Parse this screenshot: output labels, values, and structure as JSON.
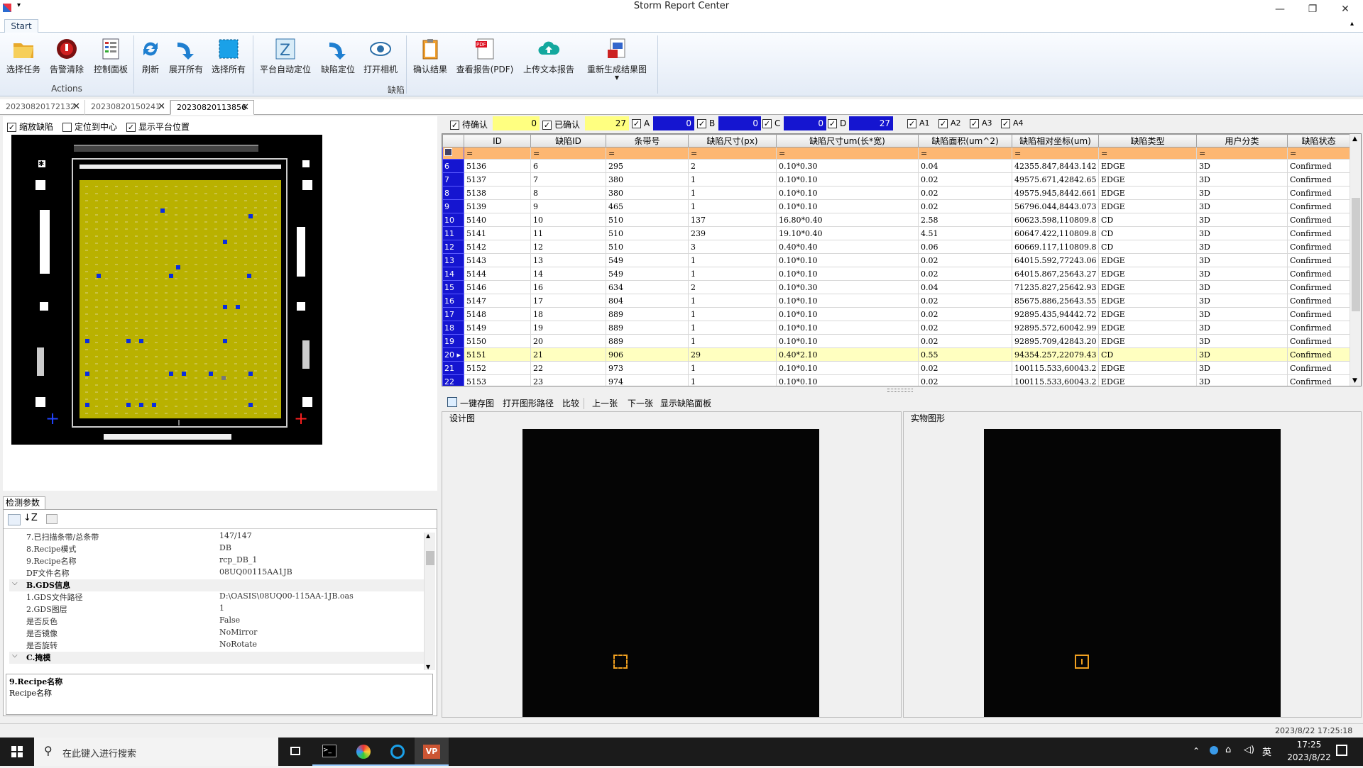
{
  "window": {
    "title": "Storm Report Center"
  },
  "ribbon": {
    "tab": "Start",
    "buttons": [
      {
        "label": "选择任务"
      },
      {
        "label": "告警清除"
      },
      {
        "label": "控制面板"
      },
      {
        "label": "刷新"
      },
      {
        "label": "展开所有"
      },
      {
        "label": "选择所有"
      },
      {
        "label": "平台自动定位"
      },
      {
        "label": "缺陷定位"
      },
      {
        "label": "打开相机"
      },
      {
        "label": "确认结果"
      },
      {
        "label": "查看报告(PDF)"
      },
      {
        "label": "上传文本报告"
      },
      {
        "label": "重新生成结果图"
      }
    ],
    "groups": {
      "actions": "Actions",
      "defects": "缺陷"
    }
  },
  "doc_tabs": [
    {
      "label": "20230820172132"
    },
    {
      "label": "20230820150241"
    },
    {
      "label": "20230820113856"
    }
  ],
  "left": {
    "options": [
      {
        "label": "缩放缺陷",
        "checked": true
      },
      {
        "label": "定位到中心",
        "checked": false
      },
      {
        "label": "显示平台位置",
        "checked": true
      }
    ]
  },
  "params": {
    "tab": "检测参数",
    "rows": [
      {
        "k": "7.已扫描条带/总条带",
        "v": "147/147"
      },
      {
        "k": "8.Recipe模式",
        "v": "DB"
      },
      {
        "k": "9.Recipe名称",
        "v": "rcp_DB_1"
      },
      {
        "k": "DF文件名称",
        "v": "08UQ00115AA1JB"
      },
      {
        "k": "B.GDS信息",
        "v": "",
        "section": true
      },
      {
        "k": "1.GDS文件路径",
        "v": "D:\\OASIS\\08UQ00-115AA-1JB.oas"
      },
      {
        "k": "2.GDS图层",
        "v": "1"
      },
      {
        "k": "是否反色",
        "v": "False"
      },
      {
        "k": "是否镜像",
        "v": "NoMirror"
      },
      {
        "k": "是否旋转",
        "v": "NoRotate"
      },
      {
        "k": "C.掩模",
        "v": "",
        "section": true
      }
    ],
    "desc_title": "9.Recipe名称",
    "desc_text": "Recipe名称"
  },
  "filters": {
    "pending": {
      "label": "待确认",
      "value": "0"
    },
    "confirmed": {
      "label": "已确认",
      "value": "27"
    },
    "a": {
      "label": "A",
      "value": "0"
    },
    "b": {
      "label": "B",
      "value": "0"
    },
    "c": {
      "label": "C",
      "value": "0"
    },
    "d": {
      "label": "D",
      "value": "27"
    },
    "levels": [
      "A1",
      "A2",
      "A3",
      "A4"
    ]
  },
  "grid": {
    "columns": [
      "ID",
      "缺陷ID",
      "条带号",
      "缺陷尺寸(px)",
      "缺陷尺寸um(长*宽)",
      "缺陷面积(um^2)",
      "缺陷相对坐标(um)",
      "缺陷类型",
      "用户分类",
      "缺陷状态"
    ],
    "filter_symbol": "=",
    "rows": [
      {
        "n": "6",
        "id": "5136",
        "did": "6",
        "strip": "295",
        "px": "2",
        "um": "0.10*0.30",
        "area": "0.04",
        "coord": "42355.847,8443.142",
        "type": "EDGE",
        "cls": "3D",
        "st": "Confirmed"
      },
      {
        "n": "7",
        "id": "5137",
        "did": "7",
        "strip": "380",
        "px": "1",
        "um": "0.10*0.10",
        "area": "0.02",
        "coord": "49575.671,42842.65",
        "type": "EDGE",
        "cls": "3D",
        "st": "Confirmed"
      },
      {
        "n": "8",
        "id": "5138",
        "did": "8",
        "strip": "380",
        "px": "1",
        "um": "0.10*0.10",
        "area": "0.02",
        "coord": "49575.945,8442.661",
        "type": "EDGE",
        "cls": "3D",
        "st": "Confirmed"
      },
      {
        "n": "9",
        "id": "5139",
        "did": "9",
        "strip": "465",
        "px": "1",
        "um": "0.10*0.10",
        "area": "0.02",
        "coord": "56796.044,8443.073",
        "type": "EDGE",
        "cls": "3D",
        "st": "Confirmed"
      },
      {
        "n": "10",
        "id": "5140",
        "did": "10",
        "strip": "510",
        "px": "137",
        "um": "16.80*0.40",
        "area": "2.58",
        "coord": "60623.598,110809.8",
        "type": "CD",
        "cls": "3D",
        "st": "Confirmed"
      },
      {
        "n": "11",
        "id": "5141",
        "did": "11",
        "strip": "510",
        "px": "239",
        "um": "19.10*0.40",
        "area": "4.51",
        "coord": "60647.422,110809.8",
        "type": "CD",
        "cls": "3D",
        "st": "Confirmed"
      },
      {
        "n": "12",
        "id": "5142",
        "did": "12",
        "strip": "510",
        "px": "3",
        "um": "0.40*0.40",
        "area": "0.06",
        "coord": "60669.117,110809.8",
        "type": "CD",
        "cls": "3D",
        "st": "Confirmed"
      },
      {
        "n": "13",
        "id": "5143",
        "did": "13",
        "strip": "549",
        "px": "1",
        "um": "0.10*0.10",
        "area": "0.02",
        "coord": "64015.592,77243.06",
        "type": "EDGE",
        "cls": "3D",
        "st": "Confirmed"
      },
      {
        "n": "14",
        "id": "5144",
        "did": "14",
        "strip": "549",
        "px": "1",
        "um": "0.10*0.10",
        "area": "0.02",
        "coord": "64015.867,25643.27",
        "type": "EDGE",
        "cls": "3D",
        "st": "Confirmed"
      },
      {
        "n": "15",
        "id": "5146",
        "did": "16",
        "strip": "634",
        "px": "2",
        "um": "0.10*0.30",
        "area": "0.04",
        "coord": "71235.827,25642.93",
        "type": "EDGE",
        "cls": "3D",
        "st": "Confirmed"
      },
      {
        "n": "16",
        "id": "5147",
        "did": "17",
        "strip": "804",
        "px": "1",
        "um": "0.10*0.10",
        "area": "0.02",
        "coord": "85675.886,25643.55",
        "type": "EDGE",
        "cls": "3D",
        "st": "Confirmed"
      },
      {
        "n": "17",
        "id": "5148",
        "did": "18",
        "strip": "889",
        "px": "1",
        "um": "0.10*0.10",
        "area": "0.02",
        "coord": "92895.435,94442.72",
        "type": "EDGE",
        "cls": "3D",
        "st": "Confirmed"
      },
      {
        "n": "18",
        "id": "5149",
        "did": "19",
        "strip": "889",
        "px": "1",
        "um": "0.10*0.10",
        "area": "0.02",
        "coord": "92895.572,60042.99",
        "type": "EDGE",
        "cls": "3D",
        "st": "Confirmed"
      },
      {
        "n": "19",
        "id": "5150",
        "did": "20",
        "strip": "889",
        "px": "1",
        "um": "0.10*0.10",
        "area": "0.02",
        "coord": "92895.709,42843.20",
        "type": "EDGE",
        "cls": "3D",
        "st": "Confirmed"
      },
      {
        "n": "20",
        "id": "5151",
        "did": "21",
        "strip": "906",
        "px": "29",
        "um": "0.40*2.10",
        "area": "0.55",
        "coord": "94354.257,22079.43",
        "type": "CD",
        "cls": "3D",
        "st": "Confirmed",
        "selected": true
      },
      {
        "n": "21",
        "id": "5152",
        "did": "22",
        "strip": "973",
        "px": "1",
        "um": "0.10*0.10",
        "area": "0.02",
        "coord": "100115.533,60043.2",
        "type": "EDGE",
        "cls": "3D",
        "st": "Confirmed"
      },
      {
        "n": "22",
        "id": "5153",
        "did": "23",
        "strip": "974",
        "px": "1",
        "um": "0.10*0.10",
        "area": "0.02",
        "coord": "100115.533,60043.2",
        "type": "EDGE",
        "cls": "3D",
        "st": "Confirmed"
      }
    ]
  },
  "image_toolbar": [
    {
      "label": "一键存图"
    },
    {
      "label": "打开图形路径"
    },
    {
      "label": "比较"
    },
    {
      "label": "上一张"
    },
    {
      "label": "下一张"
    },
    {
      "label": "显示缺陷面板"
    }
  ],
  "images": {
    "design": "设计图",
    "real": "实物图形"
  },
  "status": {
    "datetime": "2023/8/22 17:25:18"
  },
  "taskbar": {
    "search_placeholder": "在此键入进行搜索",
    "time": "17:25",
    "date": "2023/8/22",
    "ime": "英"
  },
  "colors": {
    "accent": "#1515d0",
    "wafer": "#b9b100",
    "defect": "#0a2ee0",
    "filter_row": "#fdb772"
  }
}
